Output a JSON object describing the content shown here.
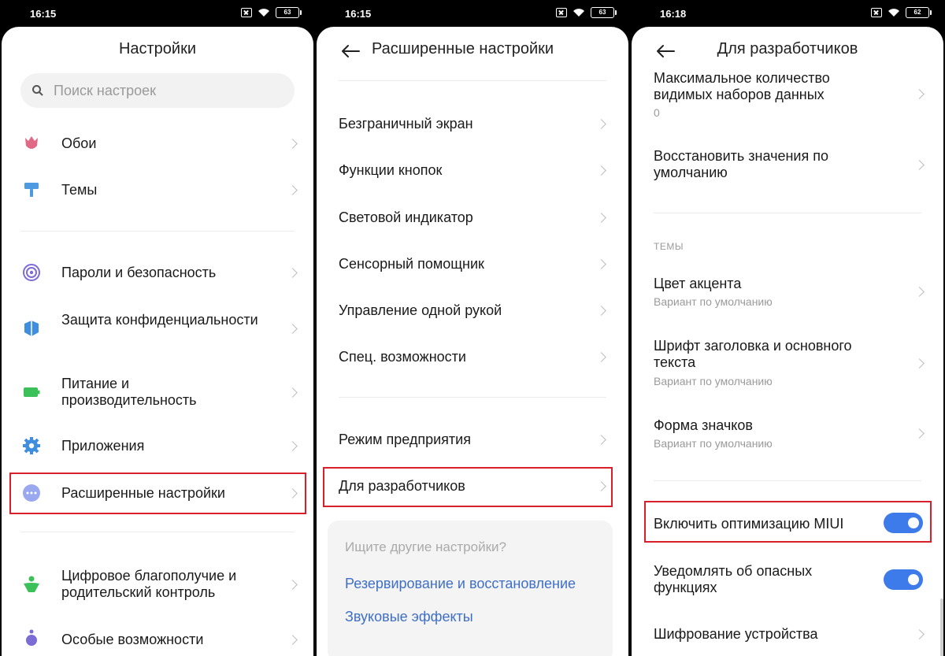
{
  "screens": [
    {
      "time": "16:15",
      "battery": "63",
      "title": "Настройки",
      "search_placeholder": "Поиск настроек",
      "items": [
        {
          "icon": "tulip-icon",
          "label": "Обои"
        },
        {
          "icon": "paint-roller-icon",
          "label": "Темы"
        },
        {
          "icon": "fingerprint-icon",
          "label": "Пароли и безопасность"
        },
        {
          "icon": "shield-icon",
          "label": "Защита конфиденциальности"
        },
        {
          "icon": "battery-icon",
          "label": "Питание и производительность"
        },
        {
          "icon": "gear-icon",
          "label": "Приложения"
        },
        {
          "icon": "more-dots-icon",
          "label": "Расширенные настройки"
        },
        {
          "icon": "wellbeing-icon",
          "label": "Цифровое благополучие и родительский контроль"
        },
        {
          "icon": "accessibility-icon",
          "label": "Особые возможности"
        }
      ]
    },
    {
      "time": "16:15",
      "battery": "63",
      "title": "Расширенные настройки",
      "items": [
        {
          "label": "Безграничный экран"
        },
        {
          "label": "Функции кнопок"
        },
        {
          "label": "Световой индикатор"
        },
        {
          "label": "Сенсорный помощник"
        },
        {
          "label": "Управление одной рукой"
        },
        {
          "label": "Спец. возможности"
        },
        {
          "label": "Режим предприятия"
        },
        {
          "label": "Для разработчиков"
        }
      ],
      "card": {
        "question": "Ищите другие настройки?",
        "links": [
          "Резервирование и восстановление",
          "Звуковые эффекты"
        ]
      }
    },
    {
      "time": "16:18",
      "battery": "62",
      "title": "Для разработчиков",
      "items": [
        {
          "label": "Максимальное количество видимых наборов данных",
          "sub": "0"
        },
        {
          "label": "Восстановить значения по умолчанию"
        }
      ],
      "section": "ТЕМЫ",
      "theme_items": [
        {
          "label": "Цвет акцента",
          "sub": "Вариант по умолчанию"
        },
        {
          "label": "Шрифт заголовка и основного текста",
          "sub": "Вариант по умолчанию"
        },
        {
          "label": "Форма значков",
          "sub": "Вариант по умолчанию"
        }
      ],
      "toggles": [
        {
          "label": "Включить оптимизацию MIUI",
          "on": true
        },
        {
          "label": "Уведомлять об опасных функциях",
          "on": true
        }
      ],
      "last_item": {
        "label": "Шифрование устройства"
      }
    }
  ],
  "colors": {
    "accent": "#3e7bea",
    "highlight": "#d9202a",
    "link": "#3f6fc4"
  }
}
